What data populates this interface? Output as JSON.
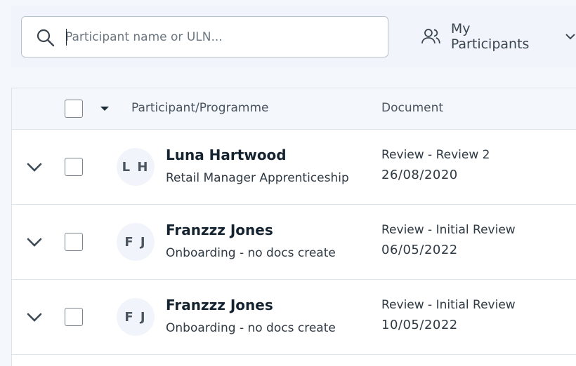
{
  "search": {
    "placeholder": "Participant name or ULN..."
  },
  "filter": {
    "label": "My Participants"
  },
  "table": {
    "columns": {
      "participant": "Participant/Programme",
      "document": "Document"
    },
    "rows": [
      {
        "initials": "L H",
        "name": "Luna Hartwood",
        "programme": "Retail Manager Apprenticeship",
        "document_title": "Review - Review 2",
        "document_date": "26/08/2020"
      },
      {
        "initials": "F J",
        "name": "Franzzz Jones",
        "programme": "Onboarding - no docs create",
        "document_title": "Review - Initial Review",
        "document_date": "06/05/2022"
      },
      {
        "initials": "F J",
        "name": "Franzzz Jones",
        "programme": "Onboarding - no docs create",
        "document_title": "Review - Initial Review",
        "document_date": "10/05/2022"
      }
    ]
  },
  "icons": {
    "search": "search-icon",
    "people": "people-icon",
    "chevron": "chevron-down-icon"
  }
}
